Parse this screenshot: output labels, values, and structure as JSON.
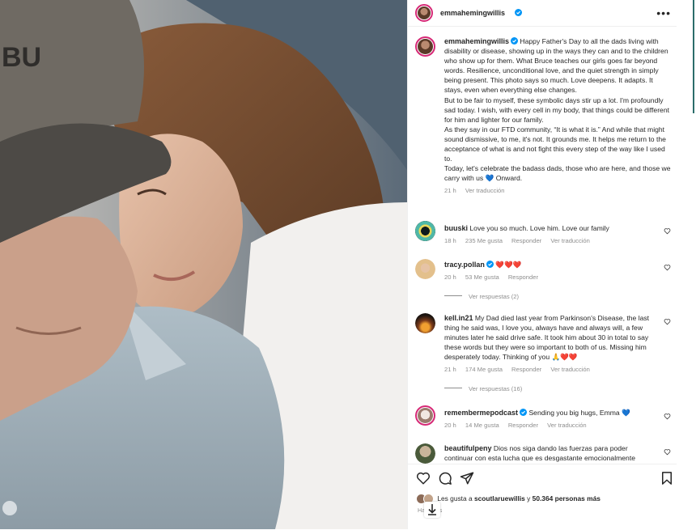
{
  "post": {
    "username": "emmahemingwillis",
    "caption": {
      "username": "emmahemingwillis",
      "paragraphs": [
        "Happy Father's Day to all the dads living with disability or disease, showing up in the ways they can and to the children who show up for them. What Bruce teaches our girls goes far beyond words. Resilience, unconditional love, and the quiet strength in simply being present. This photo says so much. Love deepens. It adapts. It stays, even when everything else changes.",
        "But to be fair to myself, these symbolic days stir up a lot. I'm profoundly sad today. I wish, with every cell in my body, that things could be different for him and lighter for our family.",
        "As they say in our FTD community, “It is what it is.” And while that might sound dismissive, to me, it's not. It grounds me. It helps me return to the acceptance of what is and not fight this every step of the way like I used to.",
        "Today, let's celebrate the badass dads, those who are here, and those we carry with us 💙 Onward."
      ],
      "time": "21 h",
      "translate": "Ver traducción"
    },
    "photo_cap_text": "BU"
  },
  "comments": [
    {
      "user": "buuski",
      "text": "Love you so much. Love him. Love our family",
      "time": "18 h",
      "likes": "235 Me gusta",
      "reply": "Responder",
      "translate": "Ver traducción"
    },
    {
      "user": "tracy.pollan",
      "text": "❤️❤️❤️",
      "time": "20 h",
      "likes": "53 Me gusta",
      "reply": "Responder",
      "view_replies": "Ver respuestas (2)"
    },
    {
      "user": "kell.in21",
      "text": "My Dad died last year from Parkinson's Disease, the last thing he said was, I love you, always have and always will, a few minutes later he said drive safe. It took him about 30 in total to say these words but they were so important to both of us. Missing him desperately today. Thinking of you 🙏❤️❤️",
      "time": "21 h",
      "likes": "174 Me gusta",
      "reply": "Responder",
      "translate": "Ver traducción",
      "view_replies": "Ver respuestas (16)"
    },
    {
      "user": "remembermepodcast",
      "text": "Sending you big hugs, Emma 💙",
      "time": "20 h",
      "likes": "14 Me gusta",
      "reply": "Responder",
      "translate": "Ver traducción"
    },
    {
      "user": "beautifulpeny",
      "text": "Dios nos siga dando las fuerzas para poder continuar con esta lucha que es desgastante emocionalmente"
    }
  ],
  "likes_line": {
    "prefix": "Les gusta a",
    "user": "scoutlaruewillis",
    "middle": "y",
    "count": "50.364 personas más"
  },
  "ago": "Ha     oras",
  "icons": [
    "more-icon",
    "heart-icon",
    "comment-icon",
    "share-icon",
    "bookmark-icon",
    "verified-icon",
    "download-icon"
  ],
  "colors": {
    "verified": "#0095f6",
    "meta": "#8e8e8e",
    "text": "#262626",
    "ring": "#d62976"
  }
}
